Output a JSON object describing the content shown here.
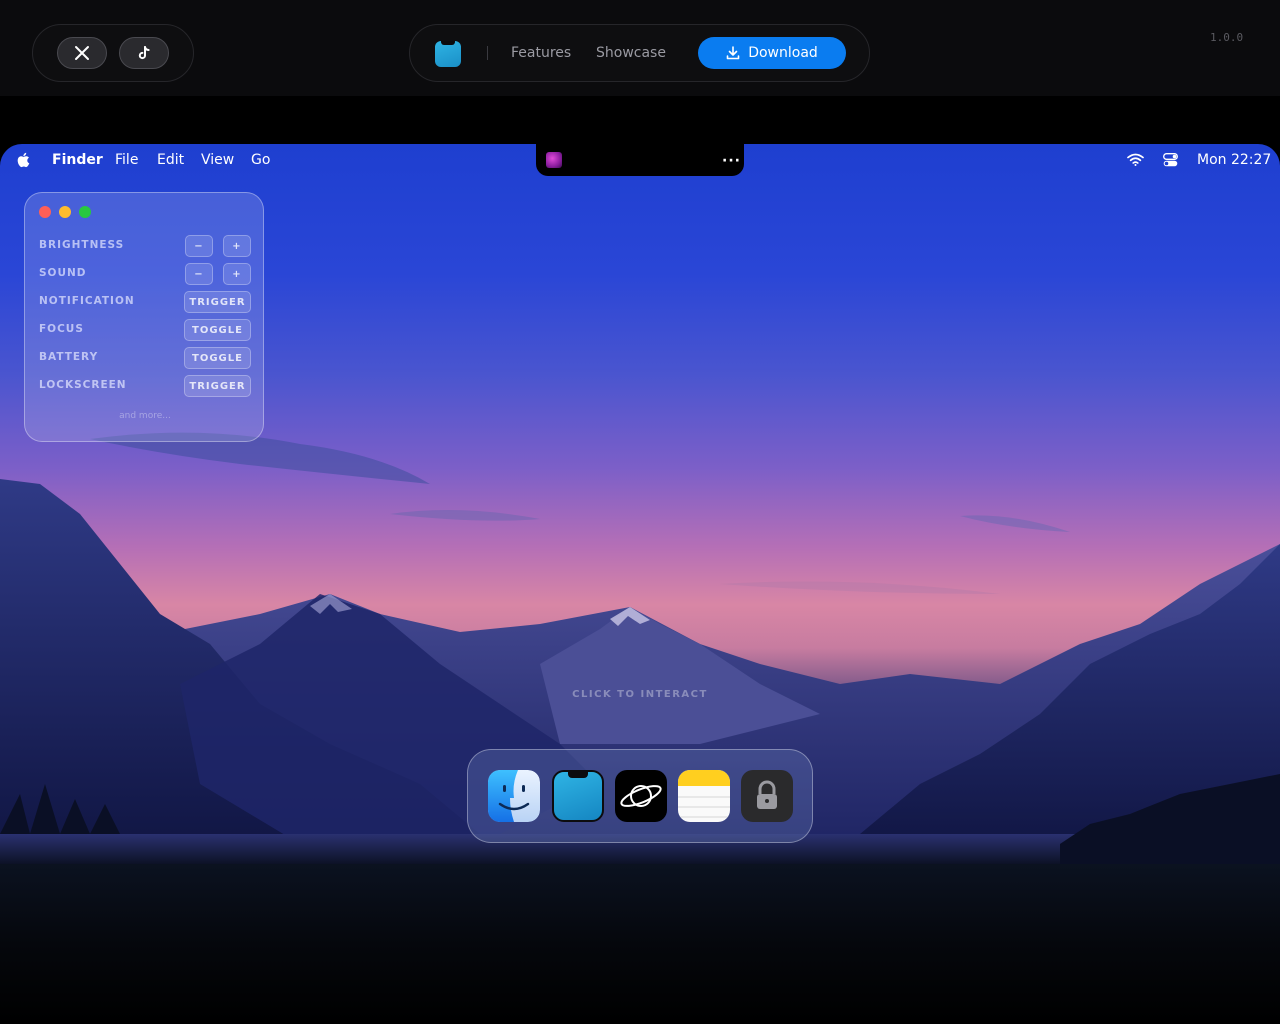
{
  "site": {
    "social": [
      {
        "name": "x",
        "icon": "x-logo-icon"
      },
      {
        "name": "tiktok",
        "icon": "tiktok-logo-icon"
      }
    ],
    "nav": {
      "features": "Features",
      "showcase": "Showcase",
      "download": "Download"
    },
    "version": "1.0.0",
    "accent": "#0a7cf0"
  },
  "menubar": {
    "app": "Finder",
    "items": [
      "File",
      "Edit",
      "View",
      "Go"
    ],
    "clock": "Mon 22:27"
  },
  "notch": {
    "more": "···"
  },
  "panel": {
    "rows": [
      {
        "label": "BRIGHTNESS",
        "type": "stepper",
        "minus": "−",
        "plus": "+"
      },
      {
        "label": "SOUND",
        "type": "stepper",
        "minus": "−",
        "plus": "+"
      },
      {
        "label": "NOTIFICATION",
        "type": "action",
        "action": "TRIGGER"
      },
      {
        "label": "FOCUS",
        "type": "action",
        "action": "TOGGLE"
      },
      {
        "label": "BATTERY",
        "type": "action",
        "action": "TOGGLE"
      },
      {
        "label": "LOCKSCREEN",
        "type": "action",
        "action": "TRIGGER"
      }
    ],
    "more": "and more..."
  },
  "hint": "CLICK TO INTERACT",
  "dock": [
    {
      "name": "finder",
      "icon": "finder-icon"
    },
    {
      "name": "notch-app",
      "icon": "notch-app-icon"
    },
    {
      "name": "saturn",
      "icon": "saturn-icon"
    },
    {
      "name": "notes",
      "icon": "notes-icon"
    },
    {
      "name": "lock",
      "icon": "lock-icon"
    }
  ]
}
